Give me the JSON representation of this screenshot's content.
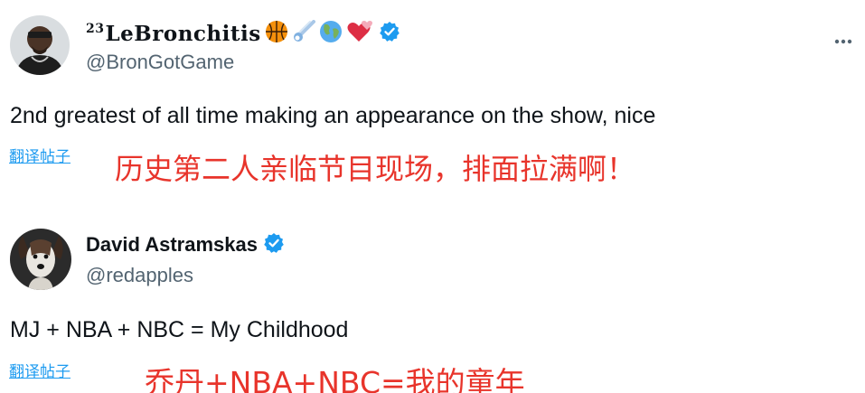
{
  "tweets": [
    {
      "name_prefix": "23",
      "display_name": "LeBronchitis",
      "name_emoji": [
        "basketball-icon",
        "comet-icon",
        "globe-icon",
        "hearts-icon"
      ],
      "verified": true,
      "handle": "@BronGotGame",
      "text": "2nd greatest of all time making an appearance on the show, nice",
      "translate_label": "翻译帖子",
      "translation_overlay": "历史第二人亲临节目现场，排面拉满啊！"
    },
    {
      "display_name": "David Astramskas",
      "verified": true,
      "handle": "@redapples",
      "text": "MJ + NBA + NBC = My Childhood",
      "translate_label": "翻译帖子",
      "translation_overlay": "乔丹+NBA+NBC=我的童年"
    }
  ],
  "colors": {
    "verified_blue": "#1d9bf0",
    "handle_gray": "#536471",
    "translation_red": "#e8342b",
    "link_blue": "#1d9bf0"
  }
}
